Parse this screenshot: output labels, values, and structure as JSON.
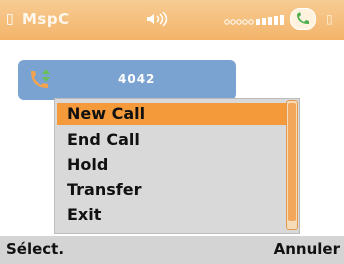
{
  "status_bar": {
    "app_name": "MspC"
  },
  "call": {
    "number": "4042"
  },
  "menu": {
    "items": [
      {
        "label": "New Call"
      },
      {
        "label": "End Call"
      },
      {
        "label": "Hold"
      },
      {
        "label": "Transfer"
      },
      {
        "label": "Exit"
      }
    ],
    "selected_index": 0
  },
  "softkeys": {
    "left": "Sélect.",
    "right": "Annuler"
  },
  "colors": {
    "status_bar": "#f3b46a",
    "selection": "#f49a3a",
    "call_card": "#7aa3d1",
    "softkey_bar": "#d4d4d4"
  }
}
